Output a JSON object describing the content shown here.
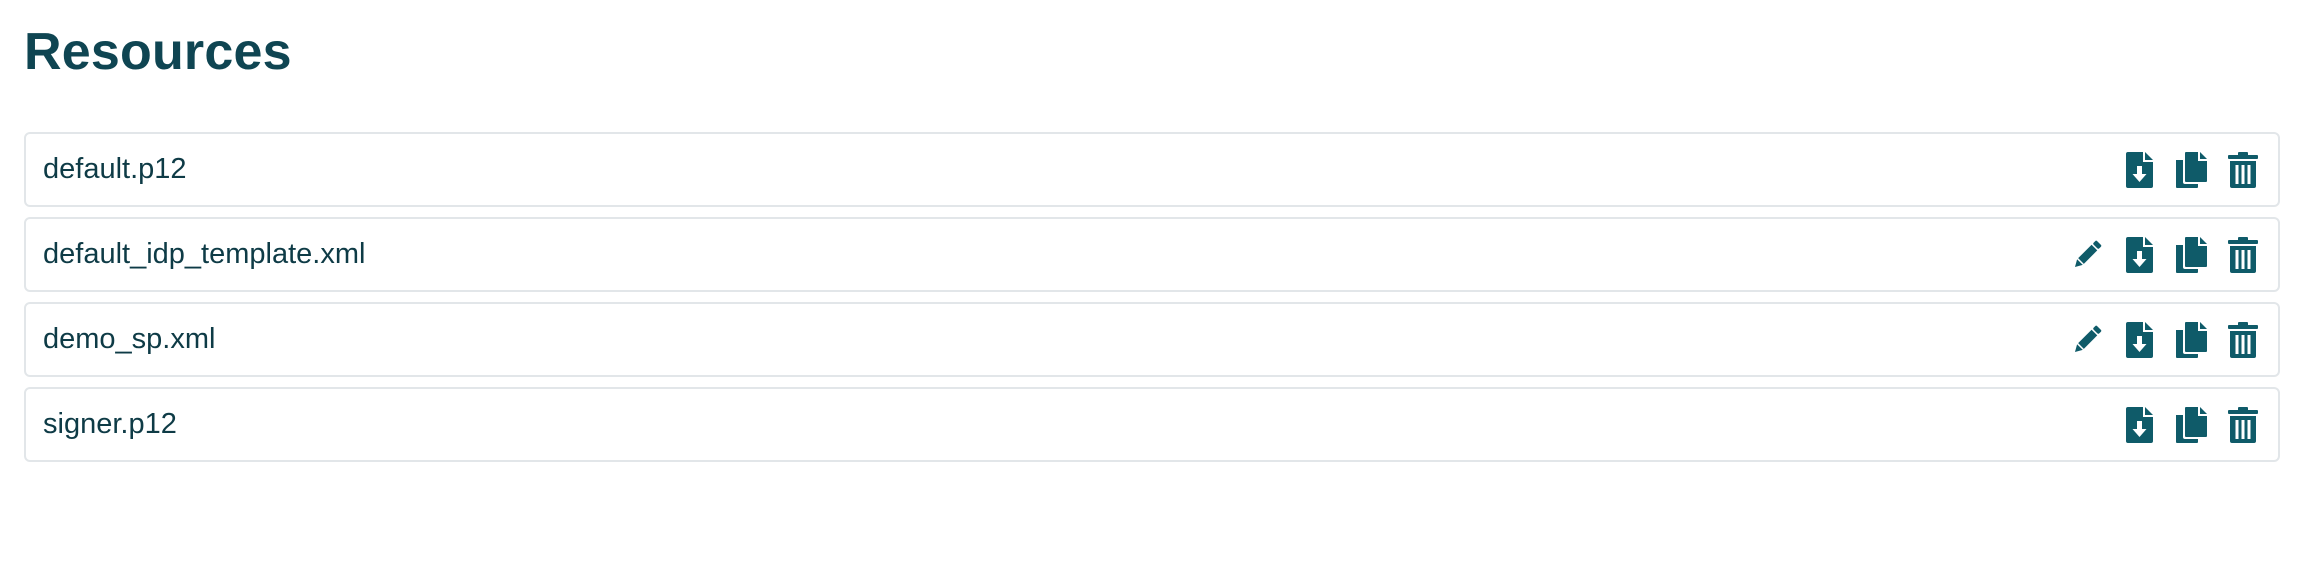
{
  "page": {
    "title": "Resources"
  },
  "colors": {
    "icon": "#0f5b69",
    "title": "#0f4552",
    "text": "#0e3b46",
    "border": "#e2e6e9"
  },
  "resources": [
    {
      "name": "default.p12",
      "actions": [
        "download-icon",
        "copy-icon",
        "trash-icon"
      ]
    },
    {
      "name": "default_idp_template.xml",
      "actions": [
        "pencil-icon",
        "download-icon",
        "copy-icon",
        "trash-icon"
      ]
    },
    {
      "name": "demo_sp.xml",
      "actions": [
        "pencil-icon",
        "download-icon",
        "copy-icon",
        "trash-icon"
      ]
    },
    {
      "name": "signer.p12",
      "actions": [
        "download-icon",
        "copy-icon",
        "trash-icon"
      ]
    }
  ]
}
